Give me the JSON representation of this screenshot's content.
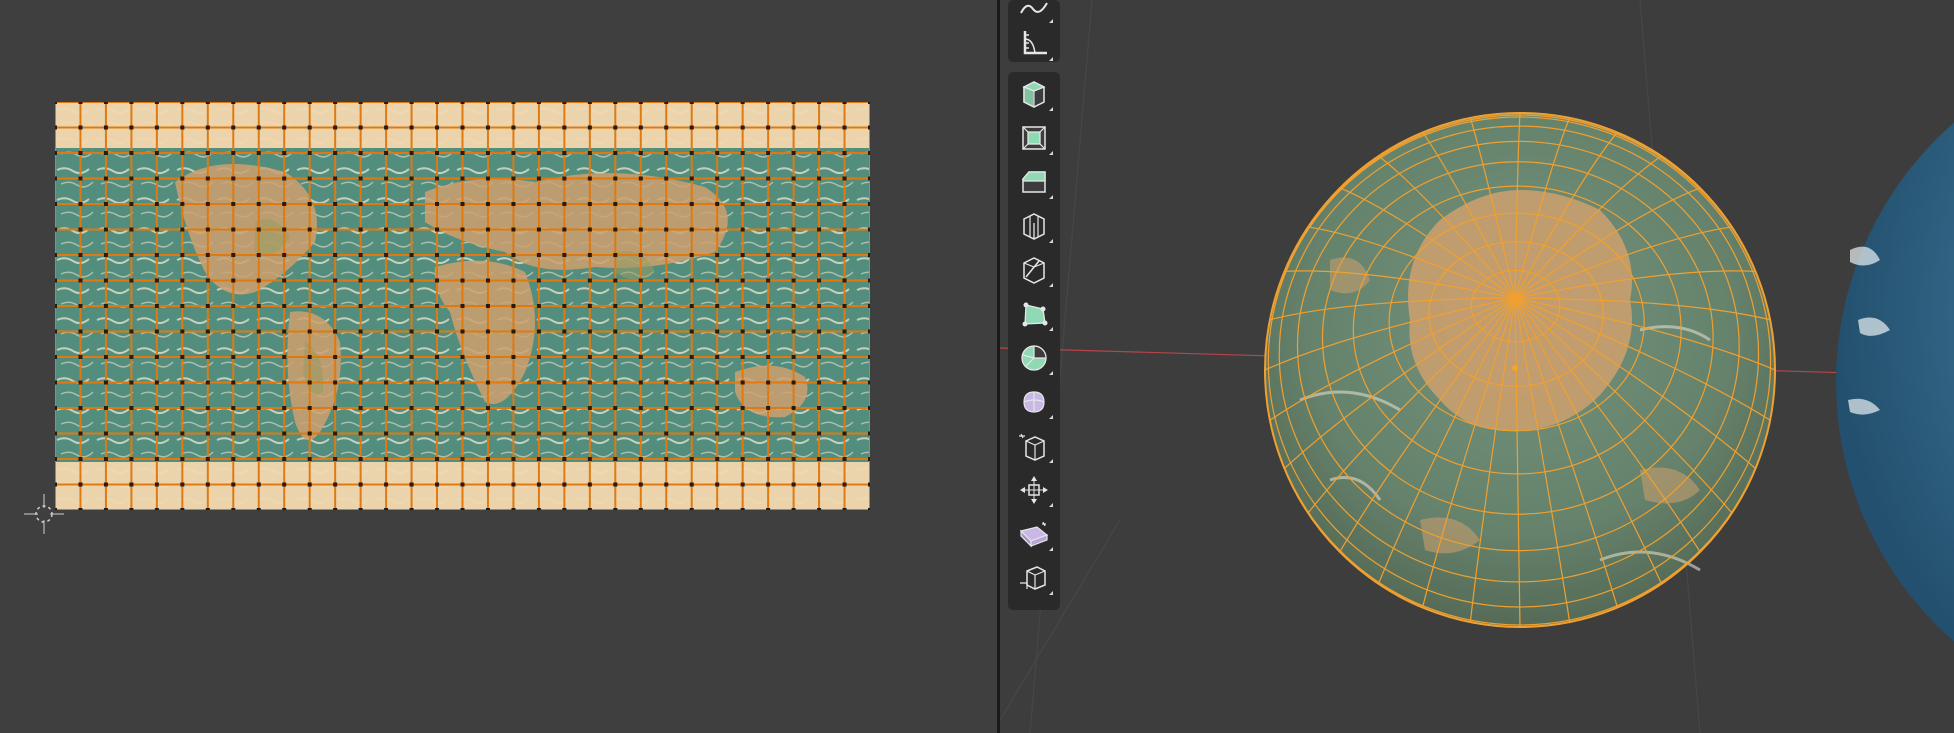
{
  "app": {
    "editors": [
      "uv-editor",
      "3d-viewport"
    ]
  },
  "theme": {
    "background": "#3d3d3d",
    "uv_edge_color": "#e07a10",
    "selection_color": "#f5a623",
    "wireframe_color": "#f0a030",
    "toolbar_bg": "#2a2a2a",
    "tool_icon_green": "#8fd9b4",
    "tool_icon_purple": "#c9b7e6",
    "axis_red": "#b4454a"
  },
  "uv_grid": {
    "columns": 32,
    "rows": 16
  },
  "toolbar": {
    "tools": [
      {
        "name": "smooth-curve-icon"
      },
      {
        "name": "measure-icon"
      },
      {
        "name": "add-cube-icon"
      },
      {
        "name": "extrude-region-icon"
      },
      {
        "name": "inset-faces-icon"
      },
      {
        "name": "bevel-icon"
      },
      {
        "name": "loop-cut-icon"
      },
      {
        "name": "knife-icon"
      },
      {
        "name": "poly-build-icon"
      },
      {
        "name": "spin-icon"
      },
      {
        "name": "smooth-vertices-icon"
      },
      {
        "name": "edge-slide-icon"
      },
      {
        "name": "shrink-fatten-icon"
      },
      {
        "name": "shear-icon"
      },
      {
        "name": "rip-region-icon"
      }
    ]
  },
  "viewport": {
    "selected_object": "uv-sphere",
    "sphere_segments": 32,
    "sphere_rings": 16
  }
}
